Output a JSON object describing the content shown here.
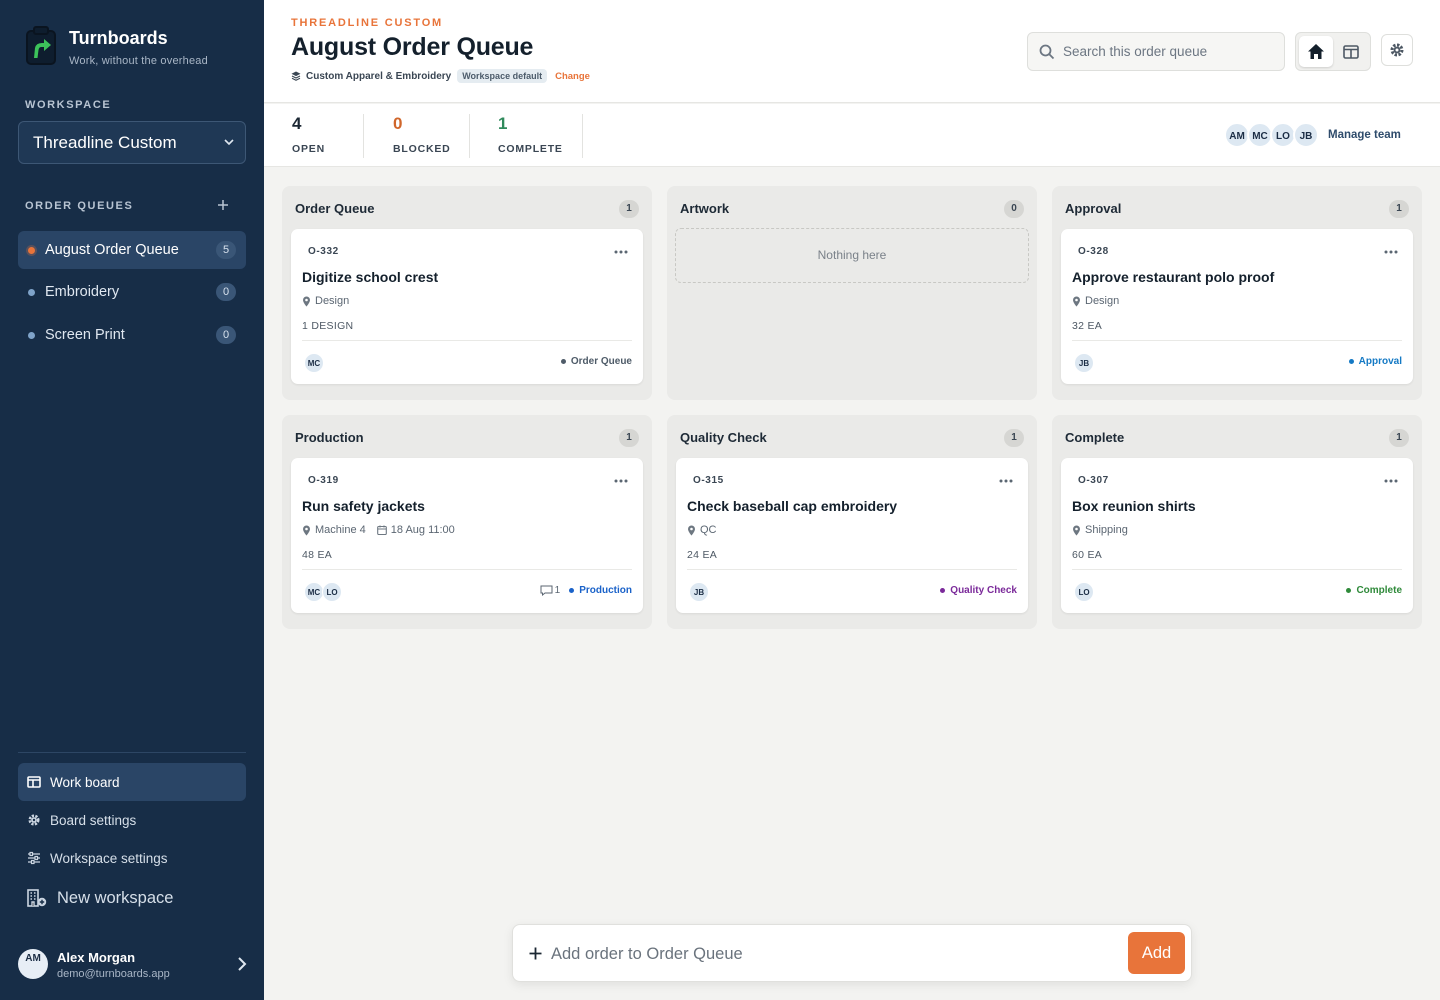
{
  "app": {
    "name": "Turnboards",
    "tagline": "Work, without the overhead"
  },
  "sidebar": {
    "workspace_label": "WORKSPACE",
    "workspace_selected": "Threadline Custom",
    "order_queues_label": "ORDER QUEUES",
    "queues": [
      {
        "label": "August Order Queue",
        "count": "5",
        "active": true
      },
      {
        "label": "Embroidery",
        "count": "0",
        "active": false
      },
      {
        "label": "Screen Print",
        "count": "0",
        "active": false
      }
    ],
    "nav": [
      {
        "label": "Work board",
        "icon": "board-icon",
        "active": true
      },
      {
        "label": "Board settings",
        "icon": "gear-icon",
        "active": false
      },
      {
        "label": "Workspace settings",
        "icon": "sliders-icon",
        "active": false
      },
      {
        "label": "New workspace",
        "icon": "building-add-icon",
        "active": false
      }
    ],
    "user": {
      "initials": "AM",
      "name": "Alex Morgan",
      "email": "demo@turnboards.app"
    }
  },
  "header": {
    "eyebrow": "THREADLINE CUSTOM",
    "title": "August Order Queue",
    "template": "Custom Apparel & Embroidery",
    "badge": "Workspace default",
    "change_label": "Change",
    "search_placeholder": "Search this order queue"
  },
  "stats": [
    {
      "value": "4",
      "label": "OPEN",
      "color": "#1b2733"
    },
    {
      "value": "0",
      "label": "BLOCKED",
      "color": "#d0662b"
    },
    {
      "value": "1",
      "label": "COMPLETE",
      "color": "#2f8a5b"
    }
  ],
  "team": {
    "members": [
      "AM",
      "MC",
      "LO",
      "JB"
    ],
    "manage_label": "Manage team"
  },
  "columns": [
    {
      "title": "Order Queue",
      "count": "1",
      "cards": [
        {
          "id": "O-332",
          "title": "Digitize school crest",
          "location": "Design",
          "date": "",
          "qty": "1 DESIGN",
          "assignees": [
            "MC"
          ],
          "comments": "",
          "status": "Order Queue",
          "status_color": "#4e5b68"
        }
      ]
    },
    {
      "title": "Artwork",
      "count": "0",
      "empty_text": "Nothing here",
      "cards": []
    },
    {
      "title": "Approval",
      "count": "1",
      "cards": [
        {
          "id": "O-328",
          "title": "Approve restaurant polo proof",
          "location": "Design",
          "date": "",
          "qty": "32 EA",
          "assignees": [
            "JB"
          ],
          "comments": "",
          "status": "Approval",
          "status_color": "#1479c4"
        }
      ]
    },
    {
      "title": "Production",
      "count": "1",
      "cards": [
        {
          "id": "O-319",
          "title": "Run safety jackets",
          "location": "Machine 4",
          "date": "18 Aug 11:00",
          "qty": "48 EA",
          "assignees": [
            "MC",
            "LO"
          ],
          "comments": "1",
          "status": "Production",
          "status_color": "#1a62c9"
        }
      ]
    },
    {
      "title": "Quality Check",
      "count": "1",
      "cards": [
        {
          "id": "O-315",
          "title": "Check baseball cap embroidery",
          "location": "QC",
          "date": "",
          "qty": "24 EA",
          "assignees": [
            "JB"
          ],
          "comments": "",
          "status": "Quality Check",
          "status_color": "#7b2a9a"
        }
      ]
    },
    {
      "title": "Complete",
      "count": "1",
      "cards": [
        {
          "id": "O-307",
          "title": "Box reunion shirts",
          "location": "Shipping",
          "date": "",
          "qty": "60 EA",
          "assignees": [
            "LO"
          ],
          "comments": "",
          "status": "Complete",
          "status_color": "#2f8a3a"
        }
      ]
    }
  ],
  "quick_add": {
    "placeholder": "Add order to Order Queue",
    "button_label": "Add"
  },
  "colors": {
    "sidebar": "#172d47",
    "accent": "#e8743a"
  }
}
